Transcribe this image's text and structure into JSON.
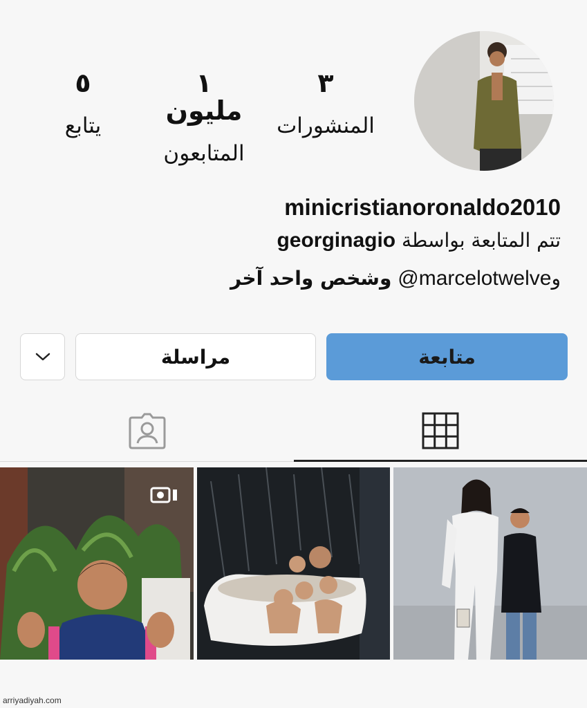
{
  "profile": {
    "username": "minicristianoronaldo2010",
    "stats": {
      "posts_count": "٣",
      "posts_label": "المنشورات",
      "followers_count": "١ مليون",
      "followers_label": "المتابعون",
      "following_count": "٥",
      "following_label": "يتابع"
    },
    "followed_by": {
      "prefix": "تتم المتابعة بواسطة",
      "user1": "georginagio",
      "line2_prefix": "و",
      "user2": "marcelotwelve@",
      "line2_suffix": "وشخص واحد آخر"
    }
  },
  "actions": {
    "follow_label": "متابعة",
    "message_label": "مراسلة",
    "more_icon": "chevron-down-icon"
  },
  "tabs": {
    "grid_icon": "grid-icon",
    "tagged_icon": "tagged-person-icon",
    "active": "grid"
  },
  "colors": {
    "follow_button": "#5b9bd8",
    "background": "#f7f7f7"
  },
  "footer": {
    "watermark": "arriyadiyah.com"
  }
}
